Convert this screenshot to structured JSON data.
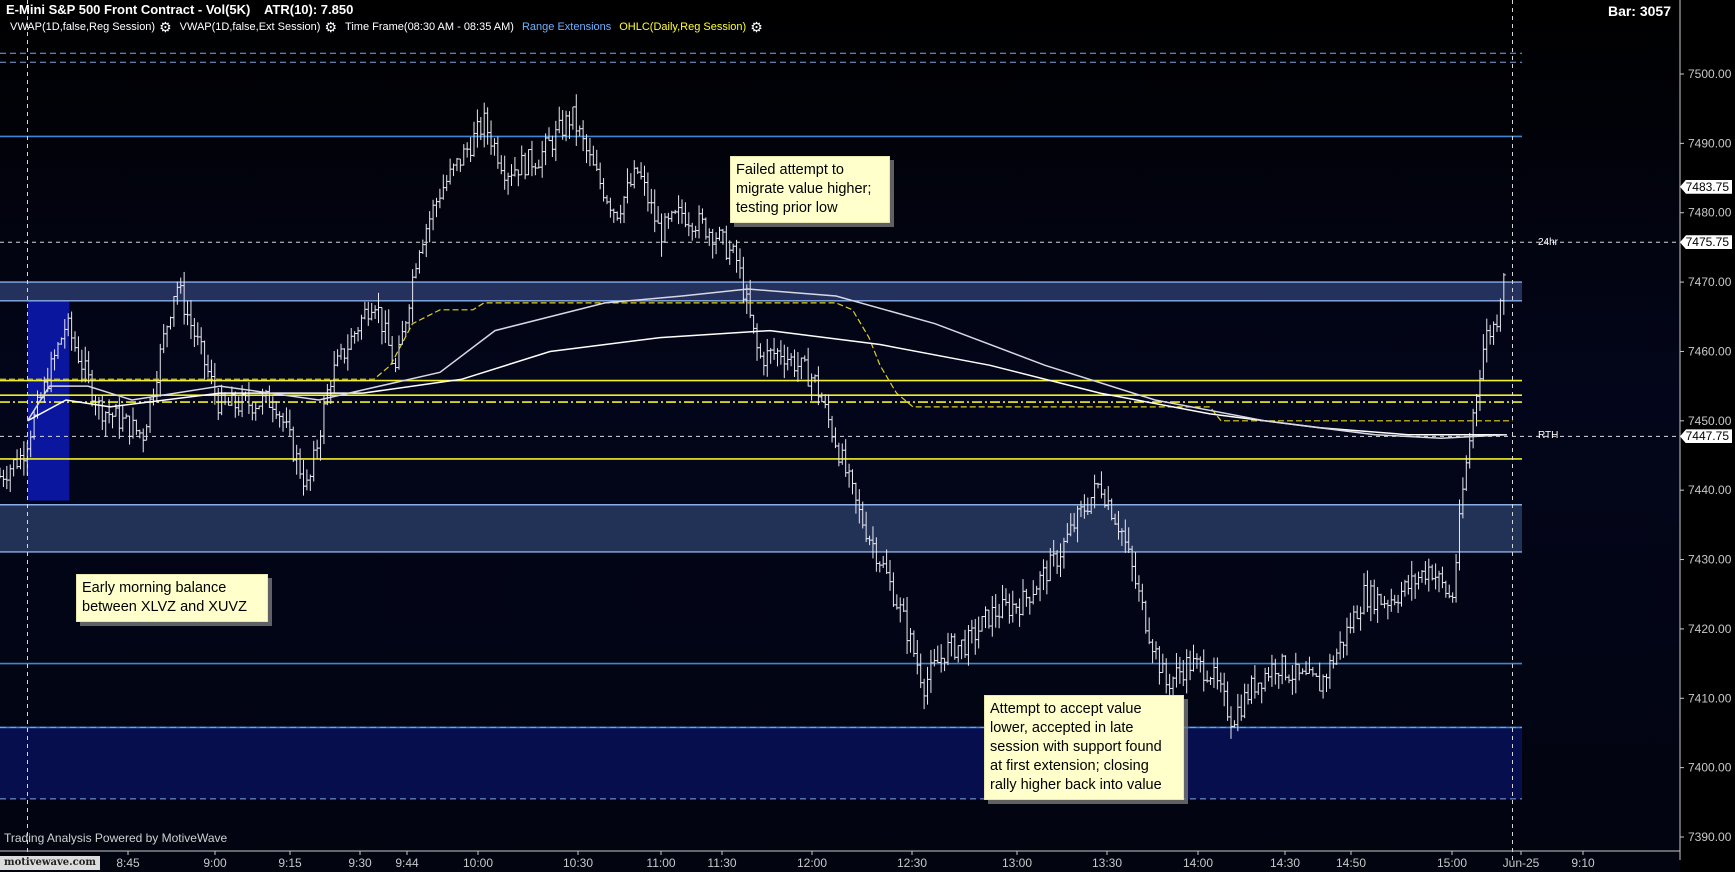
{
  "header": {
    "title": "E-Mini S&P 500 Front Contract - Vol(5K)",
    "atr": "ATR(10): 7.850",
    "bar": "Bar: 3057"
  },
  "studies": [
    {
      "label": "VWAP(1D,false,Reg Session)",
      "color": "#ffffff",
      "gear": true
    },
    {
      "label": "VWAP(1D,false,Ext Session)",
      "color": "#ffffff",
      "gear": true
    },
    {
      "label": "Time Frame(08:30 AM - 08:35 AM)",
      "color": "#ffffff",
      "gear": false
    },
    {
      "label": "Range Extensions",
      "color": "#6fb0ff",
      "gear": false
    },
    {
      "label": "OHLC(Daily,Reg Session)",
      "color": "#ffff33",
      "gear": true
    }
  ],
  "footer": "Trading Analysis Powered by MotiveWave",
  "logo_text": "motivewave.com",
  "annotations": {
    "failed": [
      "Failed attempt to",
      "migrate value higher;",
      "testing prior low"
    ],
    "balance": [
      "Early morning balance",
      "between XLVZ and XUVZ"
    ],
    "attempt": [
      "Attempt to accept value",
      "lower, accepted in late",
      "session with support found",
      "at first extension; closing",
      "rally higher back into value"
    ]
  },
  "flags": {
    "h24": "24hr",
    "rth": "RTH"
  },
  "price_tags": [
    {
      "value": "7483.75",
      "price": 7483.75
    },
    {
      "value": "7475.75",
      "price": 7475.75
    },
    {
      "value": "7447.75",
      "price": 7447.75
    }
  ],
  "colors": {
    "background_top": "#000000",
    "background_mid": "#050a28",
    "band_blue": "#2a3e80",
    "level_blue": "#3d86d6",
    "level_yellow": "#f0f028",
    "ohlc_dash": "#e0d020",
    "vwap": "#e8e8e8"
  },
  "chart_data": {
    "type": "bar",
    "title": "E-Mini S&P 500 Front Contract - Vol(5K)",
    "ylim": [
      7387,
      7520
    ],
    "y_ticks": [
      7390,
      7400,
      7410,
      7420,
      7430,
      7440,
      7450,
      7460,
      7470,
      7480,
      7490,
      7500
    ],
    "y_tick_labels": [
      "7390.00",
      "7400.00",
      "7410.00",
      "7420.00",
      "7430.00",
      "7440.00",
      "7450.00",
      "7460.00",
      "7470.00",
      "7480.00",
      "7490.00",
      "7500.00"
    ],
    "x_ticks": [
      "8:45",
      "9:00",
      "9:15",
      "9:30",
      "9:44",
      "10:00",
      "10:30",
      "11:00",
      "11:30",
      "12:00",
      "12:30",
      "13:00",
      "13:30",
      "14:00",
      "14:30",
      "14:50",
      "15:00",
      "Jun-25",
      "9:10"
    ],
    "price_path": [
      [
        0,
        7442
      ],
      [
        20,
        7445
      ],
      [
        60,
        7464
      ],
      [
        90,
        7452
      ],
      [
        130,
        7448
      ],
      [
        160,
        7470
      ],
      [
        200,
        7452
      ],
      [
        250,
        7453
      ],
      [
        280,
        7440
      ],
      [
        300,
        7456
      ],
      [
        340,
        7468
      ],
      [
        360,
        7457
      ],
      [
        380,
        7475
      ],
      [
        400,
        7483
      ],
      [
        420,
        7488
      ],
      [
        440,
        7493
      ],
      [
        460,
        7486
      ],
      [
        490,
        7488
      ],
      [
        520,
        7494
      ],
      [
        540,
        7486
      ],
      [
        560,
        7480
      ],
      [
        580,
        7486
      ],
      [
        600,
        7477
      ],
      [
        620,
        7480
      ],
      [
        650,
        7477
      ],
      [
        670,
        7473
      ],
      [
        690,
        7459
      ],
      [
        710,
        7460
      ],
      [
        740,
        7456
      ],
      [
        760,
        7447
      ],
      [
        780,
        7437
      ],
      [
        800,
        7430
      ],
      [
        820,
        7422
      ],
      [
        840,
        7412
      ],
      [
        860,
        7417
      ],
      [
        880,
        7418
      ],
      [
        900,
        7422
      ],
      [
        930,
        7424
      ],
      [
        960,
        7430
      ],
      [
        980,
        7436
      ],
      [
        1000,
        7441
      ],
      [
        1020,
        7434
      ],
      [
        1040,
        7422
      ],
      [
        1060,
        7412
      ],
      [
        1080,
        7415
      ],
      [
        1100,
        7414
      ],
      [
        1120,
        7407
      ],
      [
        1140,
        7412
      ],
      [
        1160,
        7415
      ],
      [
        1180,
        7413
      ],
      [
        1200,
        7412
      ],
      [
        1220,
        7418
      ],
      [
        1240,
        7425
      ],
      [
        1260,
        7424
      ],
      [
        1280,
        7426
      ],
      [
        1300,
        7429
      ],
      [
        1320,
        7424
      ],
      [
        1330,
        7440
      ],
      [
        1340,
        7452
      ],
      [
        1350,
        7462
      ],
      [
        1360,
        7464
      ],
      [
        1368,
        7473
      ]
    ],
    "vwap_reg": [
      [
        25,
        7450
      ],
      [
        45,
        7455
      ],
      [
        80,
        7455
      ],
      [
        120,
        7453
      ],
      [
        200,
        7455
      ],
      [
        290,
        7453
      ],
      [
        400,
        7457
      ],
      [
        450,
        7463
      ],
      [
        550,
        7467
      ],
      [
        620,
        7468
      ],
      [
        680,
        7469
      ],
      [
        760,
        7468
      ],
      [
        850,
        7464
      ],
      [
        950,
        7458
      ],
      [
        1050,
        7453
      ],
      [
        1150,
        7450
      ],
      [
        1250,
        7448
      ],
      [
        1310,
        7447.5
      ],
      [
        1370,
        7448
      ]
    ],
    "vwap_ext": [
      [
        25,
        7450
      ],
      [
        60,
        7453
      ],
      [
        100,
        7452
      ],
      [
        200,
        7454
      ],
      [
        290,
        7454
      ],
      [
        330,
        7454
      ],
      [
        420,
        7456
      ],
      [
        500,
        7460
      ],
      [
        600,
        7462
      ],
      [
        700,
        7463
      ],
      [
        800,
        7461
      ],
      [
        900,
        7458
      ],
      [
        1000,
        7454
      ],
      [
        1100,
        7451
      ],
      [
        1200,
        7449
      ],
      [
        1280,
        7448
      ],
      [
        1370,
        7448
      ]
    ],
    "ohlc_step": [
      [
        0,
        7456
      ],
      [
        340,
        7456
      ],
      [
        355,
        7458
      ],
      [
        375,
        7464
      ],
      [
        400,
        7466
      ],
      [
        430,
        7466
      ],
      [
        440,
        7467
      ],
      [
        760,
        7467
      ],
      [
        775,
        7466
      ],
      [
        790,
        7462
      ],
      [
        800,
        7458
      ],
      [
        815,
        7454
      ],
      [
        830,
        7452
      ],
      [
        1100,
        7452
      ],
      [
        1110,
        7450
      ],
      [
        1340,
        7450
      ],
      [
        1375,
        7450
      ]
    ],
    "levels_yellow": [
      7455.8,
      7453.7,
      7452.7,
      7444.5
    ],
    "levels_blue": [
      7491,
      7415,
      7405.8
    ],
    "levels_blue_dashed": [
      7503,
      7501.7,
      7405.8,
      7395.5
    ],
    "band_upper": [
      7467.3,
      7470
    ],
    "band_lower": [
      7431.1,
      7437.9
    ],
    "band_bottom": [
      7395.5,
      7405.8
    ],
    "opening_range": {
      "x": [
        25,
        63
      ],
      "y": [
        7438.5,
        7467.3
      ]
    }
  }
}
